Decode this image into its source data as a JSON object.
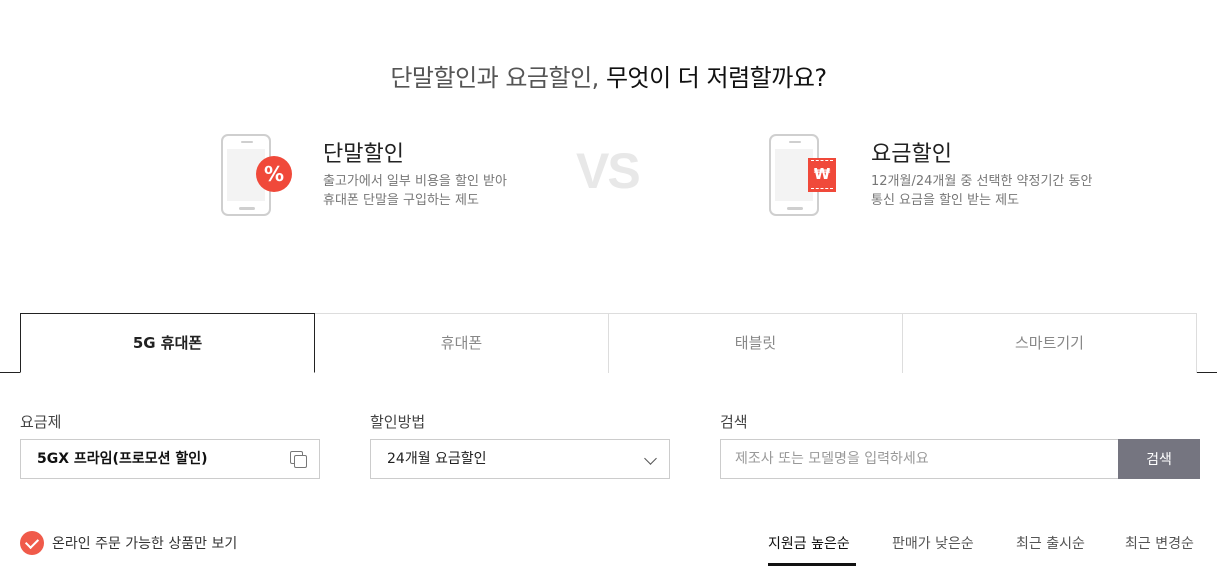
{
  "headline": {
    "light": "단말할인과 요금할인,",
    "strong": " 무엇이 더 저렴할까요?"
  },
  "compare": {
    "left": {
      "title": "단말할인",
      "desc1": "출고가에서 일부 비용을 할인 받아",
      "desc2": "휴대폰 단말을 구입하는 제도",
      "badge": "%"
    },
    "vs": "VS",
    "right": {
      "title": "요금할인",
      "desc1": "12개월/24개월 중 선택한 약정기간 동안",
      "desc2": "통신 요금을 할인 받는 제도",
      "badge": "₩"
    }
  },
  "tabs": [
    "5G 휴대폰",
    "휴대폰",
    "태블릿",
    "스마트기기"
  ],
  "filters": {
    "plan_label": "요금제",
    "plan_value": "5GX 프라임(프로모션 할인)",
    "discount_label": "할인방법",
    "discount_value": "24개월 요금할인",
    "search_label": "검색",
    "search_placeholder": "제조사 또는 모델명을 입력하세요",
    "search_button": "검색"
  },
  "online_only": "온라인 주문 가능한 상품만 보기",
  "sort": [
    "지원금 높은순",
    "판매가 낮은순",
    "최근 출시순",
    "최근 변경순"
  ],
  "colors": {
    "accent": "#f0493a",
    "search_button": "#757580"
  },
  "icons": {
    "plan_copy": "copy-icon",
    "discount_select": "chevron-down-icon",
    "online_only": "check-icon"
  }
}
